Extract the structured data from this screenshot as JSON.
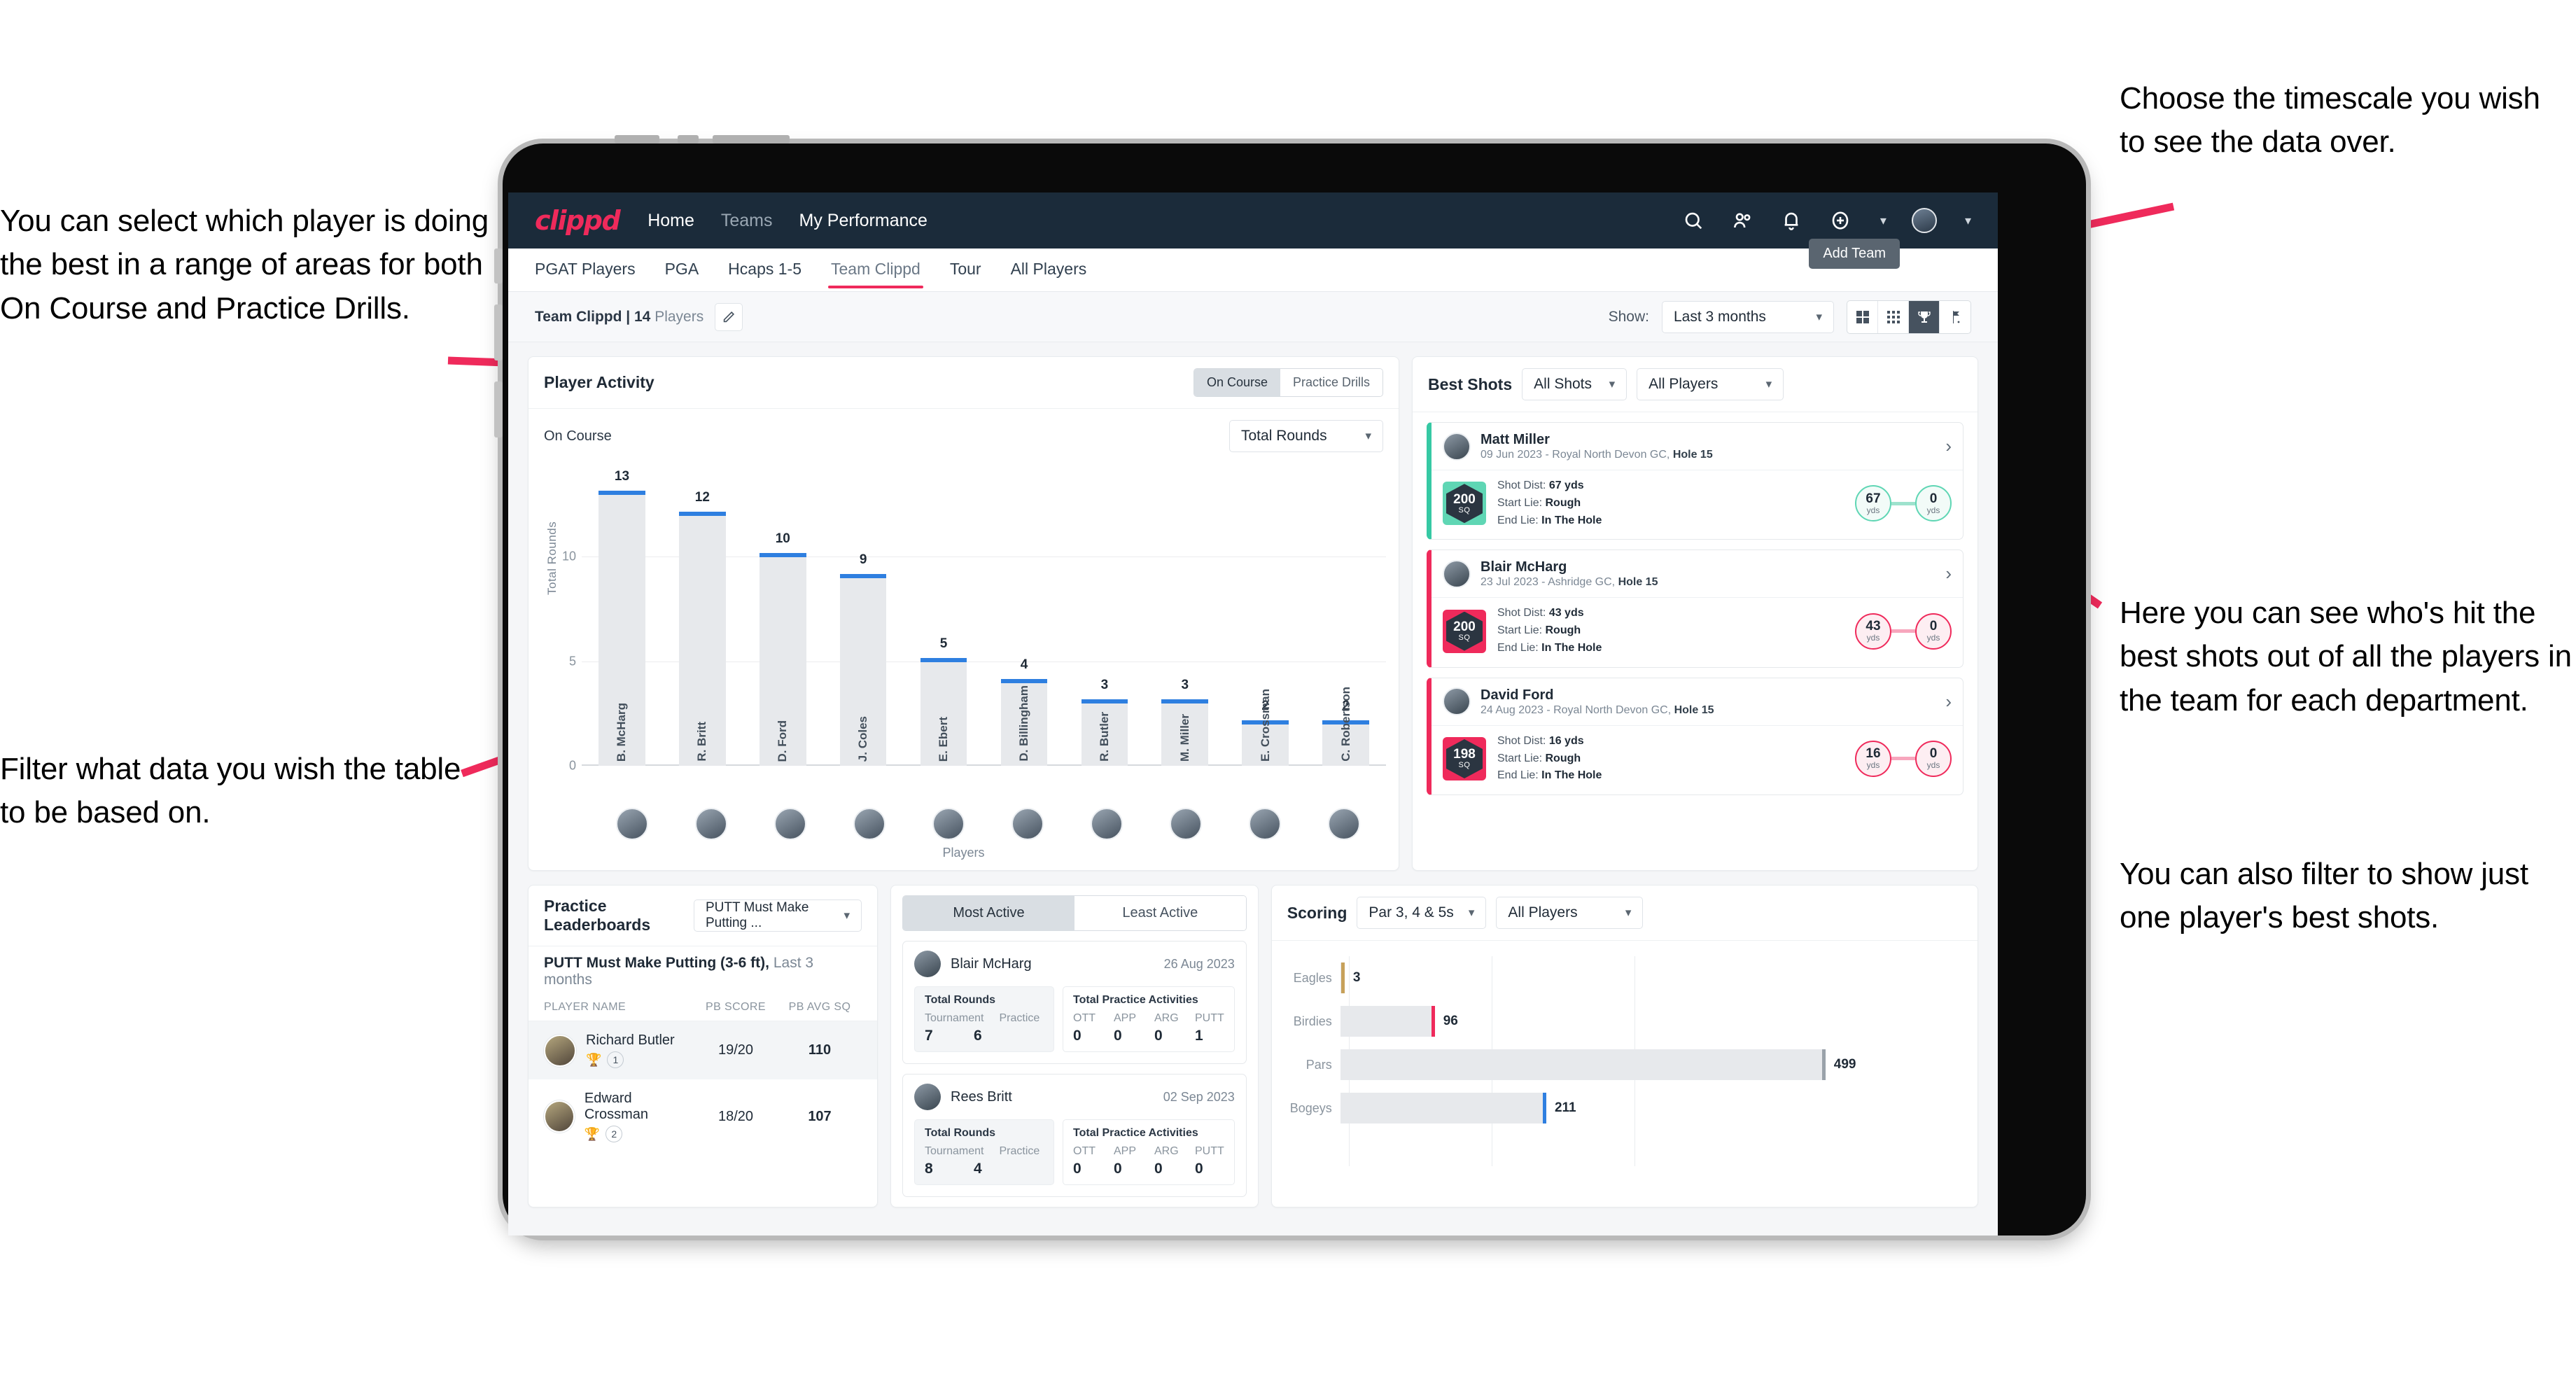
{
  "annotations": {
    "left_top": "You can select which player is doing the best in a range of areas for both On Course and Practice Drills.",
    "left_bottom": "Filter what data you wish the table to be based on.",
    "right_top": "Choose the timescale you wish to see the data over.",
    "right_mid": "Here you can see who's hit the best shots out of all the players in the team for each department.",
    "right_bottom": "You can also filter to show just one player's best shots."
  },
  "app": {
    "brand": "clippd",
    "nav": [
      {
        "label": "Home",
        "active": true
      },
      {
        "label": "Teams",
        "active": false
      },
      {
        "label": "My Performance",
        "active": false
      }
    ],
    "icons": {
      "search": "search-icon",
      "people": "people-icon",
      "bell": "bell-icon",
      "plus": "plus-circle-icon",
      "avatar": "user-avatar"
    },
    "tabs": [
      {
        "label": "PGAT Players",
        "active": false
      },
      {
        "label": "PGA",
        "active": false
      },
      {
        "label": "Hcaps 1-5",
        "active": false
      },
      {
        "label": "Team Clippd",
        "active": true
      },
      {
        "label": "Tour",
        "active": false
      },
      {
        "label": "All Players",
        "active": false
      }
    ],
    "tooltip_add_team": "Add Team"
  },
  "toolbar": {
    "team_name": "Team Clippd",
    "team_sep": " | ",
    "team_count": "14",
    "team_players_word": "Players",
    "edit_icon": "pencil-icon",
    "show_label": "Show:",
    "timescale_value": "Last 3 months",
    "view_buttons": [
      {
        "name": "grid-large-icon",
        "active": false
      },
      {
        "name": "grid-small-icon",
        "active": false
      },
      {
        "name": "trophy-icon",
        "active": true
      },
      {
        "name": "flag-icon",
        "active": false
      }
    ]
  },
  "player_activity": {
    "title": "Player Activity",
    "segments": [
      {
        "label": "On Course",
        "active": true
      },
      {
        "label": "Practice Drills",
        "active": false
      }
    ],
    "sub_label": "On Course",
    "metric_select": "Total Rounds"
  },
  "best_shots": {
    "title": "Best Shots",
    "filter_shots": "All Shots",
    "filter_players": "All Players",
    "cards": [
      {
        "player": "Matt Miller",
        "meta_plain": "09 Jun 2023 - Royal North Devon GC, ",
        "meta_bold": "Hole 15",
        "badge_value": "200",
        "badge_unit": "SQ",
        "accent": "#36c9a4",
        "shot_dist_label": "Shot Dist: ",
        "shot_dist_value": "67 yds",
        "start_lie_label": "Start Lie: ",
        "start_lie_value": "Rough",
        "end_lie_label": "End Lie: ",
        "end_lie_value": "In The Hole",
        "from_value": "67",
        "from_unit": "yds",
        "to_value": "0",
        "to_unit": "yds"
      },
      {
        "player": "Blair McHarg",
        "meta_plain": "23 Jul 2023 - Ashridge GC, ",
        "meta_bold": "Hole 15",
        "badge_value": "200",
        "badge_unit": "SQ",
        "accent": "#ef2a5b",
        "shot_dist_label": "Shot Dist: ",
        "shot_dist_value": "43 yds",
        "start_lie_label": "Start Lie: ",
        "start_lie_value": "Rough",
        "end_lie_label": "End Lie: ",
        "end_lie_value": "In The Hole",
        "from_value": "43",
        "from_unit": "yds",
        "to_value": "0",
        "to_unit": "yds"
      },
      {
        "player": "David Ford",
        "meta_plain": "24 Aug 2023 - Royal North Devon GC, ",
        "meta_bold": "Hole 15",
        "badge_value": "198",
        "badge_unit": "SQ",
        "accent": "#ef2a5b",
        "shot_dist_label": "Shot Dist: ",
        "shot_dist_value": "16 yds",
        "start_lie_label": "Start Lie: ",
        "start_lie_value": "Rough",
        "end_lie_label": "End Lie: ",
        "end_lie_value": "In The Hole",
        "from_value": "16",
        "from_unit": "yds",
        "to_value": "0",
        "to_unit": "yds"
      }
    ]
  },
  "practice_leaderboards": {
    "title": "Practice Leaderboards",
    "drill_select": "PUTT Must Make Putting ...",
    "subtitle_bold": "PUTT Must Make Putting (3-6 ft),",
    "subtitle_plain": " Last 3 months",
    "columns": [
      "PLAYER NAME",
      "PB SCORE",
      "PB AVG SQ"
    ],
    "rows": [
      {
        "name": "Richard Butler",
        "trophy": "gold",
        "rank": "1",
        "pb_score": "19/20",
        "pb_avg_sq": "110"
      },
      {
        "name": "Edward Crossman",
        "trophy": "silver",
        "rank": "2",
        "pb_score": "18/20",
        "pb_avg_sq": "107"
      }
    ]
  },
  "activity_panel": {
    "tabs": [
      {
        "label": "Most Active",
        "active": true
      },
      {
        "label": "Least Active",
        "active": false
      }
    ],
    "rounds_title": "Total Rounds",
    "practice_title": "Total Practice Activities",
    "rounds_cols": [
      "Tournament",
      "Practice"
    ],
    "practice_cols": [
      "OTT",
      "APP",
      "ARG",
      "PUTT"
    ],
    "cards": [
      {
        "player": "Blair McHarg",
        "date": "26 Aug 2023",
        "rounds": [
          "7",
          "6"
        ],
        "practice": [
          "0",
          "0",
          "0",
          "1"
        ]
      },
      {
        "player": "Rees Britt",
        "date": "02 Sep 2023",
        "rounds": [
          "8",
          "4"
        ],
        "practice": [
          "0",
          "0",
          "0",
          "0"
        ]
      }
    ]
  },
  "scoring": {
    "title": "Scoring",
    "filter_par": "Par 3, 4 & 5s",
    "filter_players": "All Players"
  },
  "chart_data": [
    {
      "type": "bar",
      "title": "Player Activity — On Course",
      "xlabel": "Players",
      "ylabel": "Total Rounds",
      "categories": [
        "B. McHarg",
        "R. Britt",
        "D. Ford",
        "J. Coles",
        "E. Ebert",
        "D. Billingham",
        "R. Butler",
        "M. Miller",
        "E. Crossman",
        "C. Robertson"
      ],
      "values": [
        13,
        12,
        10,
        9,
        5,
        4,
        3,
        3,
        2,
        2
      ],
      "ylim": [
        0,
        14
      ],
      "yticks": [
        0,
        5,
        10
      ],
      "grid": true,
      "bar_color": "#e7e9ec",
      "cap_color": "#2e7fe0",
      "legend": "none"
    },
    {
      "type": "bar",
      "orientation": "horizontal",
      "title": "Scoring",
      "categories": [
        "Eagles",
        "Birdies",
        "Pars",
        "Bogeys"
      ],
      "values": [
        3,
        96,
        499,
        211
      ],
      "cap_colors": [
        "#c7a15a",
        "#ef2a5b",
        "#9aa2aa",
        "#2e7fe0"
      ],
      "xlim": [
        0,
        640
      ],
      "grid": true,
      "legend": "none"
    }
  ]
}
